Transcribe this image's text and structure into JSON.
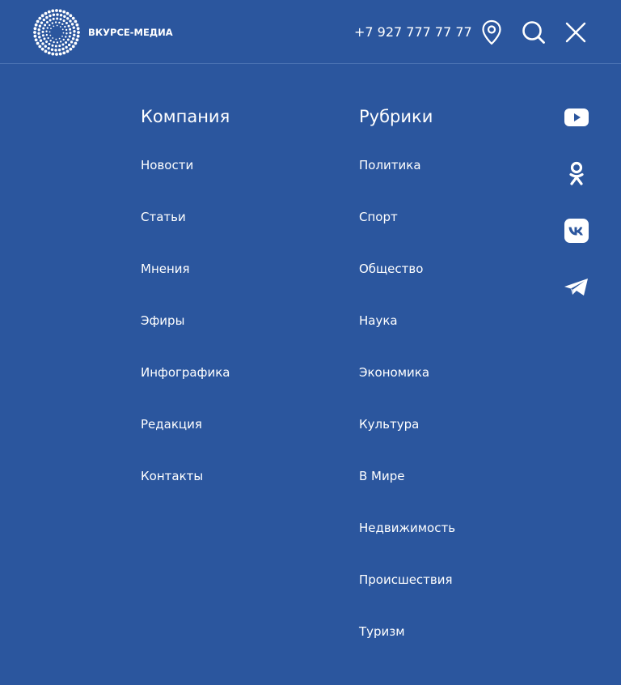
{
  "header": {
    "logo_text": "ВКУРСЕ-МЕДИА",
    "phone": "+7 927 777 77 77",
    "icons": [
      "location-pin-icon",
      "search-icon",
      "close-icon"
    ]
  },
  "menu": {
    "company": {
      "title": "Компания",
      "items": [
        "Новости",
        "Статьи",
        "Мнения",
        "Эфиры",
        "Инфографика",
        "Редакция",
        "Контакты"
      ]
    },
    "rubrics": {
      "title": "Рубрики",
      "items": [
        "Политика",
        "Спорт",
        "Общество",
        "Наука",
        "Экономика",
        "Культура",
        "В Мире",
        "Недвижимость",
        "Происшествия",
        "Туризм"
      ]
    }
  },
  "social": [
    "youtube-icon",
    "odnoklassniki-icon",
    "vk-icon",
    "telegram-icon"
  ],
  "colors": {
    "background": "#2b569e",
    "text": "#ffffff",
    "divider": "#4a72b3"
  }
}
